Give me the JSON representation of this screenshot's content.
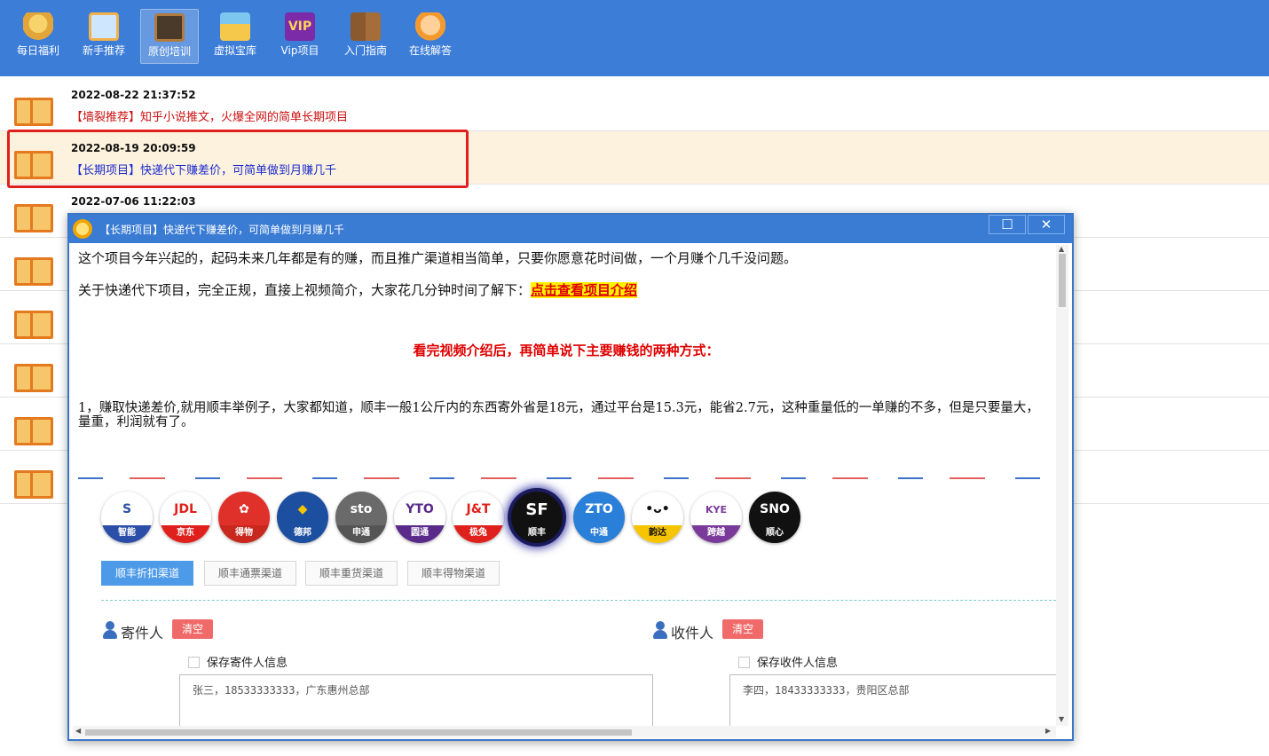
{
  "toolbar": {
    "items": [
      {
        "label": "每日福利",
        "icon": "lucky-cat-icon"
      },
      {
        "label": "新手推荐",
        "icon": "monitor-icon"
      },
      {
        "label": "原创培训",
        "icon": "blackboard-icon",
        "active": true
      },
      {
        "label": "虚拟宝库",
        "icon": "store-icon"
      },
      {
        "label": "Vip项目",
        "icon": "vip-icon",
        "icon_text": "VIP"
      },
      {
        "label": "入门指南",
        "icon": "book-icon"
      },
      {
        "label": "在线解答",
        "icon": "chat-icon"
      }
    ]
  },
  "list": {
    "rows": [
      {
        "date": "2022-08-22 21:37:52",
        "title": "【墙裂推荐】知乎小说推文，火爆全网的简单长期项目"
      },
      {
        "date": "2022-08-19 20:09:59",
        "title": "【长期项目】快递代下赚差价，可简单做到月赚几千",
        "selected": true
      },
      {
        "date": "2022-07-06 11:22:03",
        "title": ""
      },
      {
        "date": "",
        "title": ""
      },
      {
        "date": "",
        "title": ""
      },
      {
        "date": "",
        "title": ""
      },
      {
        "date": "",
        "title": ""
      },
      {
        "date": "",
        "title": ""
      }
    ]
  },
  "popup": {
    "title": "【长期项目】快递代下赚差价，可简单做到月赚几千",
    "max_glyph": "☐",
    "close_glyph": "✕",
    "p1": "这个项目今年兴起的，起码未来几年都是有的赚，而且推广渠道相当简单，只要你愿意花时间做，一个月赚个几千没问题。",
    "p2_prefix": "关于快递代下项目，完全正规，直接上视频简介，大家花几分钟时间了解下：",
    "p2_link": "点击查看项目介绍",
    "p3": "看完视频介绍后，再简单说下主要赚钱的两种方式：",
    "p4": "1，赚取快递差价,就用顺丰举例子，大家都知道，顺丰一般1公斤内的东西寄外省是18元，通过平台是15.3元，能省2.7元，这种重量低的一单赚的不多，但是只要量大，量重，利润就有了。",
    "carriers": [
      {
        "logo": "S",
        "name": "智能",
        "fg": "#2b4fa8",
        "band": "#2b4fa8"
      },
      {
        "logo": "JDL",
        "name": "京东",
        "fg": "#e0201c",
        "band": "#e0201c"
      },
      {
        "logo": "✿",
        "name": "得物",
        "fg": "#ffffff",
        "band": "#c8281e",
        "bg": "#e0302a"
      },
      {
        "logo": "◆",
        "name": "德邦",
        "fg": "#f5c400",
        "band": "#1d4fa0",
        "bg": "#1d4fa0"
      },
      {
        "logo": "sto",
        "name": "申通",
        "fg": "#ffffff",
        "band": "#555555",
        "bg": "#6a6a6a"
      },
      {
        "logo": "YTO",
        "name": "圆通",
        "fg": "#5a2a8a",
        "band": "#5a2a8a"
      },
      {
        "logo": "J&T",
        "name": "极兔",
        "fg": "#e0201c",
        "band": "#e0201c"
      },
      {
        "logo": "SF",
        "name": "顺丰",
        "fg": "#ffffff",
        "band": "#111111",
        "bg": "#111111",
        "selected": true
      },
      {
        "logo": "ZTO",
        "name": "中通",
        "fg": "#ffffff",
        "band": "#2a7fd8",
        "bg": "#2a7fd8"
      },
      {
        "logo": "•ᴗ•",
        "name": "韵达",
        "fg": "#111111",
        "band": "#f7c400"
      },
      {
        "logo": "KYE",
        "name": "跨越",
        "fg": "#7a3a9a",
        "band": "#7a3a9a"
      },
      {
        "logo": "SNO",
        "name": "顺心",
        "fg": "#ffffff",
        "band": "#111111",
        "bg": "#111111"
      }
    ],
    "tabs": [
      "顺丰折扣渠道",
      "顺丰通票渠道",
      "顺丰重货渠道",
      "顺丰得物渠道"
    ],
    "sender": {
      "label": "寄件人",
      "clear": "清空",
      "save": "保存寄件人信息",
      "address": "张三，18533333333，广东惠州总部"
    },
    "receiver": {
      "label": "收件人",
      "clear": "清空",
      "save": "保存收件人信息",
      "address": "李四，18433333333，贵阳区总部"
    }
  }
}
